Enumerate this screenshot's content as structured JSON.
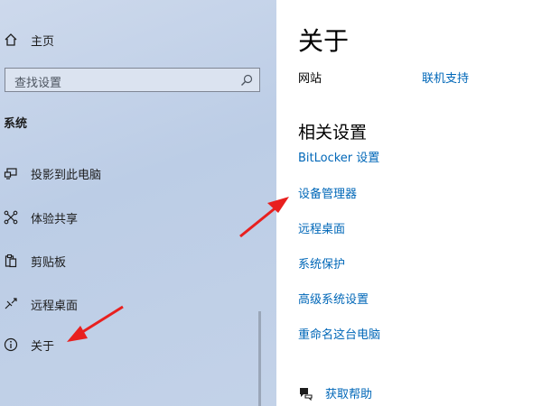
{
  "sidebar": {
    "home_label": "主页",
    "search_placeholder": "查找设置",
    "section_title": "系统",
    "items": [
      {
        "label": "投影到此电脑",
        "icon": "projector-icon"
      },
      {
        "label": "体验共享",
        "icon": "shared-experiences-icon"
      },
      {
        "label": "剪贴板",
        "icon": "clipboard-icon"
      },
      {
        "label": "远程桌面",
        "icon": "remote-desktop-icon"
      },
      {
        "label": "关于",
        "icon": "info-icon"
      }
    ]
  },
  "main": {
    "title": "关于",
    "website_label": "网站",
    "support_link": "联机支持",
    "related_title": "相关设置",
    "related_links": [
      "BitLocker 设置",
      "设备管理器",
      "远程桌面",
      "系统保护",
      "高级系统设置",
      "重命名这台电脑"
    ],
    "help_label": "获取帮助"
  },
  "colors": {
    "link": "#0067b8",
    "annotation_arrow": "#e8201f",
    "sidebar_bg": "#c3d2e8"
  }
}
